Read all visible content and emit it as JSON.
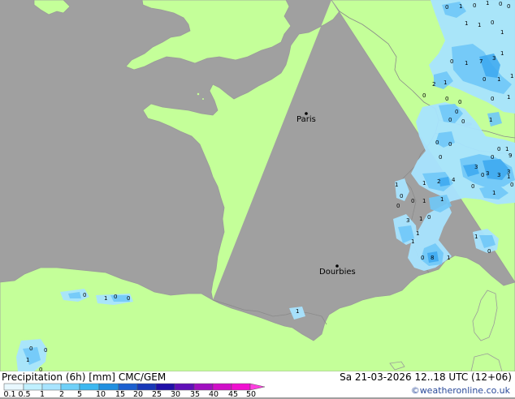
{
  "title": {
    "product": "Precipitation (6h) [mm]",
    "model": "CMC/GEM",
    "validity": "Sa 21-03-2026 12..18 UTC (12+06)"
  },
  "credit": "©weatheronline.co.uk",
  "cities": [
    {
      "name": "Paris"
    },
    {
      "name": "Dourbies"
    }
  ],
  "legend": {
    "ticks": [
      "0.1",
      "0.5",
      "1",
      "2",
      "5",
      "10",
      "15",
      "20",
      "25",
      "30",
      "35",
      "40",
      "45",
      "50"
    ],
    "colors": [
      "#e8f8ff",
      "#c0f0ff",
      "#a8e4ff",
      "#70d0f8",
      "#3cb8f0",
      "#2090e0",
      "#1c60d0",
      "#1838b8",
      "#2010a8",
      "#6010b8",
      "#a010c0",
      "#d010c8",
      "#f010d0",
      "#ff40e0"
    ]
  },
  "colors": {
    "land": "#c4ff99",
    "sea": "#a0a0a0",
    "coast": "#9a9a9a",
    "border": "#8a8a8a",
    "precip_light": "#a8e4ff",
    "precip_mid": "#70c8f8",
    "precip_heavy": "#3ca8f0"
  },
  "map_numbers": [
    "0",
    "1",
    "0",
    "1",
    "0",
    "0",
    "1",
    "1",
    "0",
    "1",
    "0",
    "1",
    "7",
    "3",
    "1",
    "0",
    "1",
    "1",
    "2",
    "1",
    "0",
    "0",
    "1",
    "0",
    "0",
    "1",
    "0",
    "0",
    "0",
    "3",
    "0",
    "9",
    "1",
    "1",
    "2",
    "4",
    "0",
    "3",
    "0",
    "0",
    "1",
    "1",
    "0",
    "0",
    "1",
    "1",
    "3",
    "1",
    "0",
    "1",
    "0",
    "8",
    "1",
    "1",
    "0",
    "0",
    "1",
    "0",
    "3",
    "3",
    "1",
    "0",
    "1",
    "0",
    "0",
    "0",
    "1",
    "0",
    "0",
    "1",
    "0",
    "0",
    "0"
  ]
}
